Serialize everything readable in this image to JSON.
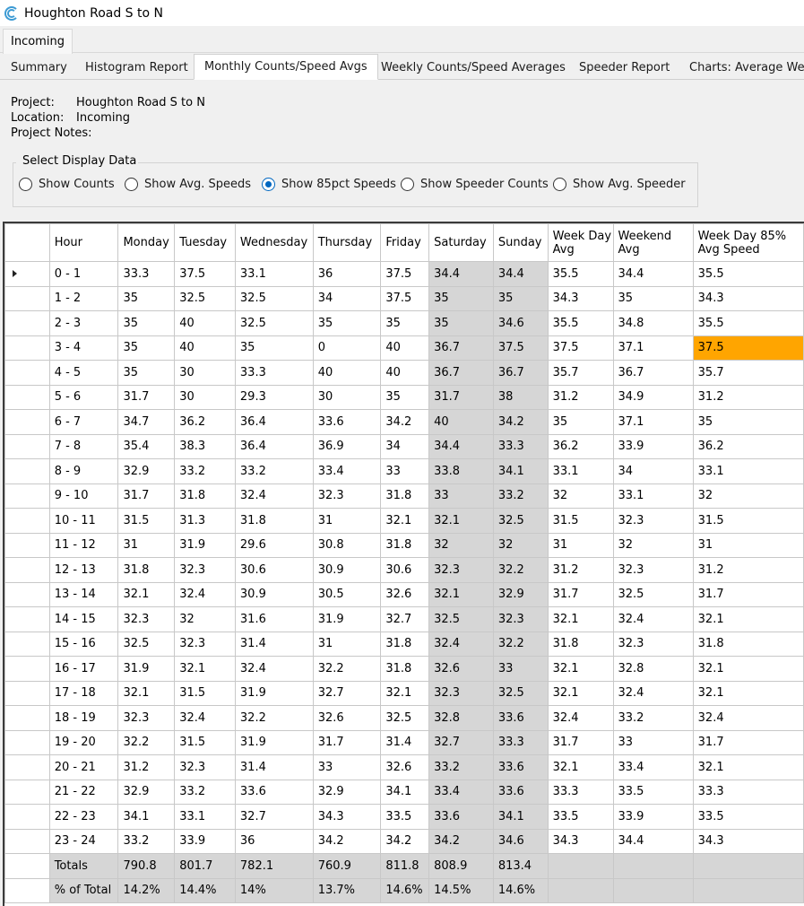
{
  "window": {
    "title": "Houghton Road S to N"
  },
  "outer_tab": "Incoming",
  "tabs": [
    {
      "label": "Summary"
    },
    {
      "label": "Histogram Report"
    },
    {
      "label": "Monthly Counts/Speed Avgs"
    },
    {
      "label": "Weekly Counts/Speed Averages"
    },
    {
      "label": "Speeder Report"
    },
    {
      "label": "Charts: Average Wee"
    }
  ],
  "info": {
    "project_label": "Project:",
    "project": "Houghton Road S to N",
    "location_label": "Location:",
    "location": "Incoming",
    "notes_label": "Project Notes:"
  },
  "display": {
    "title": "Select Display Data",
    "options": [
      "Show Counts",
      "Show Avg. Speeds",
      "Show 85pct Speeds",
      "Show Speeder Counts",
      "Show Avg. Speeder"
    ],
    "selected": "Show 85pct Speeds"
  },
  "grid": {
    "headers": [
      "Hour",
      "Monday",
      "Tuesday",
      "Wednesday",
      "Thursday",
      "Friday",
      "Saturday",
      "Sunday",
      "Week Day Avg",
      "Weekend Avg",
      "Week Day 85% Avg Speed"
    ],
    "rows": [
      [
        "0 - 1",
        "33.3",
        "37.5",
        "33.1",
        "36",
        "37.5",
        "34.4",
        "34.4",
        "35.5",
        "34.4",
        "35.5"
      ],
      [
        "1 - 2",
        "35",
        "32.5",
        "32.5",
        "34",
        "37.5",
        "35",
        "35",
        "34.3",
        "35",
        "34.3"
      ],
      [
        "2 - 3",
        "35",
        "40",
        "32.5",
        "35",
        "35",
        "35",
        "34.6",
        "35.5",
        "34.8",
        "35.5"
      ],
      [
        "3 - 4",
        "35",
        "40",
        "35",
        "0",
        "40",
        "36.7",
        "37.5",
        "37.5",
        "37.1",
        "37.5"
      ],
      [
        "4 - 5",
        "35",
        "30",
        "33.3",
        "40",
        "40",
        "36.7",
        "36.7",
        "35.7",
        "36.7",
        "35.7"
      ],
      [
        "5 - 6",
        "31.7",
        "30",
        "29.3",
        "30",
        "35",
        "31.7",
        "38",
        "31.2",
        "34.9",
        "31.2"
      ],
      [
        "6 - 7",
        "34.7",
        "36.2",
        "36.4",
        "33.6",
        "34.2",
        "40",
        "34.2",
        "35",
        "37.1",
        "35"
      ],
      [
        "7 - 8",
        "35.4",
        "38.3",
        "36.4",
        "36.9",
        "34",
        "34.4",
        "33.3",
        "36.2",
        "33.9",
        "36.2"
      ],
      [
        "8 - 9",
        "32.9",
        "33.2",
        "33.2",
        "33.4",
        "33",
        "33.8",
        "34.1",
        "33.1",
        "34",
        "33.1"
      ],
      [
        "9 - 10",
        "31.7",
        "31.8",
        "32.4",
        "32.3",
        "31.8",
        "33",
        "33.2",
        "32",
        "33.1",
        "32"
      ],
      [
        "10 - 11",
        "31.5",
        "31.3",
        "31.8",
        "31",
        "32.1",
        "32.1",
        "32.5",
        "31.5",
        "32.3",
        "31.5"
      ],
      [
        "11 - 12",
        "31",
        "31.9",
        "29.6",
        "30.8",
        "31.8",
        "32",
        "32",
        "31",
        "32",
        "31"
      ],
      [
        "12 - 13",
        "31.8",
        "32.3",
        "30.6",
        "30.9",
        "30.6",
        "32.3",
        "32.2",
        "31.2",
        "32.3",
        "31.2"
      ],
      [
        "13 - 14",
        "32.1",
        "32.4",
        "30.9",
        "30.5",
        "32.6",
        "32.1",
        "32.9",
        "31.7",
        "32.5",
        "31.7"
      ],
      [
        "14 - 15",
        "32.3",
        "32",
        "31.6",
        "31.9",
        "32.7",
        "32.5",
        "32.3",
        "32.1",
        "32.4",
        "32.1"
      ],
      [
        "15 - 16",
        "32.5",
        "32.3",
        "31.4",
        "31",
        "31.8",
        "32.4",
        "32.2",
        "31.8",
        "32.3",
        "31.8"
      ],
      [
        "16 - 17",
        "31.9",
        "32.1",
        "32.4",
        "32.2",
        "31.8",
        "32.6",
        "33",
        "32.1",
        "32.8",
        "32.1"
      ],
      [
        "17 - 18",
        "32.1",
        "31.5",
        "31.9",
        "32.7",
        "32.1",
        "32.3",
        "32.5",
        "32.1",
        "32.4",
        "32.1"
      ],
      [
        "18 - 19",
        "32.3",
        "32.4",
        "32.2",
        "32.6",
        "32.5",
        "32.8",
        "33.6",
        "32.4",
        "33.2",
        "32.4"
      ],
      [
        "19 - 20",
        "32.2",
        "31.5",
        "31.9",
        "31.7",
        "31.4",
        "32.7",
        "33.3",
        "31.7",
        "33",
        "31.7"
      ],
      [
        "20 - 21",
        "31.2",
        "32.3",
        "31.4",
        "33",
        "32.6",
        "33.2",
        "33.6",
        "32.1",
        "33.4",
        "32.1"
      ],
      [
        "21 - 22",
        "32.9",
        "33.2",
        "33.6",
        "32.9",
        "34.1",
        "33.4",
        "33.6",
        "33.3",
        "33.5",
        "33.3"
      ],
      [
        "22 - 23",
        "34.1",
        "33.1",
        "32.7",
        "34.3",
        "33.5",
        "33.6",
        "34.1",
        "33.5",
        "33.9",
        "33.5"
      ],
      [
        "23 - 24",
        "33.2",
        "33.9",
        "36",
        "34.2",
        "34.2",
        "34.2",
        "34.6",
        "34.3",
        "34.4",
        "34.3"
      ]
    ],
    "totals": [
      [
        "Totals",
        "790.8",
        "801.7",
        "782.1",
        "760.9",
        "811.8",
        "808.9",
        "813.4",
        "",
        "",
        ""
      ],
      [
        "% of Total",
        "14.2%",
        "14.4%",
        "14%",
        "13.7%",
        "14.6%",
        "14.5%",
        "14.6%",
        "",
        "",
        ""
      ]
    ],
    "highlight_color": "#FFA500",
    "highlight_cell": "3 - 4 / Week Day 85% Avg Speed"
  }
}
